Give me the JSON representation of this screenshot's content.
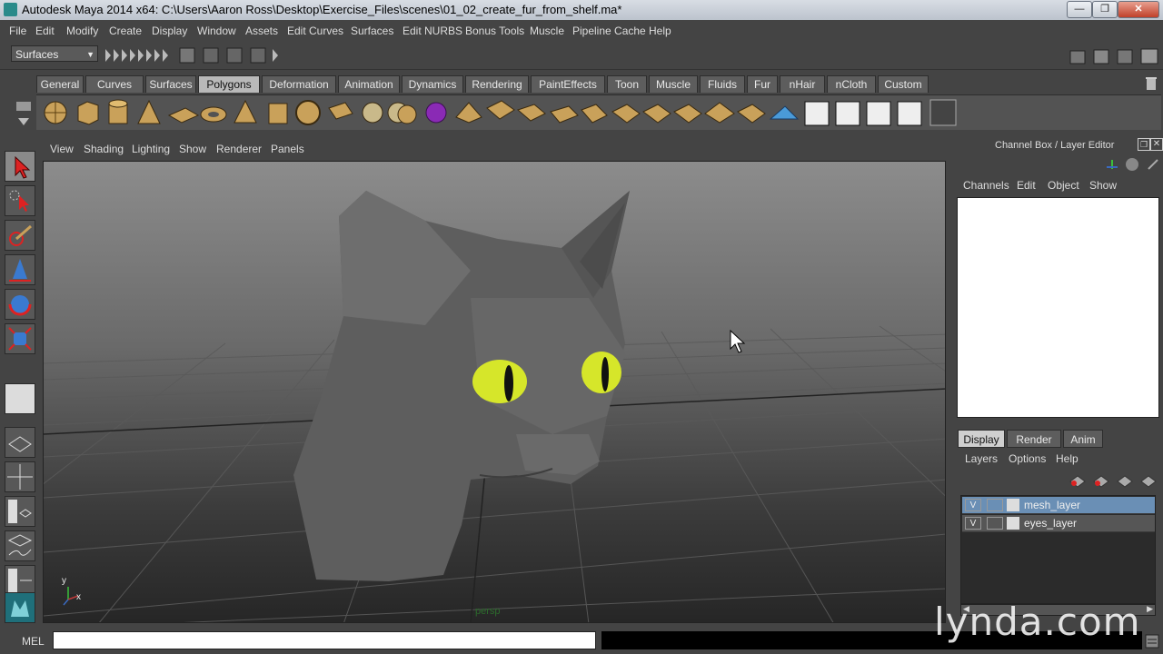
{
  "window": {
    "title": "Autodesk Maya 2014 x64: C:\\Users\\Aaron Ross\\Desktop\\Exercise_Files\\scenes\\01_02_create_fur_from_shelf.ma*",
    "minimize": "—",
    "maximize": "❐",
    "close": "✕"
  },
  "menubar": {
    "items": [
      "File",
      "Edit",
      "Modify",
      "Create",
      "Display",
      "Window",
      "Assets",
      "Edit Curves",
      "Surfaces",
      "Edit NURBS",
      "Bonus Tools",
      "Muscle",
      "Pipeline Cache",
      "Help"
    ]
  },
  "statusline": {
    "mode": "Surfaces"
  },
  "shelf": {
    "tabs": [
      "General",
      "Curves",
      "Surfaces",
      "Polygons",
      "Deformation",
      "Animation",
      "Dynamics",
      "Rendering",
      "PaintEffects",
      "Toon",
      "Muscle",
      "Fluids",
      "Fur",
      "nHair",
      "nCloth",
      "Custom"
    ],
    "active_tab": "Polygons"
  },
  "panel": {
    "menus": [
      "View",
      "Shading",
      "Lighting",
      "Show",
      "Renderer",
      "Panels"
    ],
    "camera_label": "persp",
    "axis_y": "y",
    "axis_x": "x"
  },
  "channelbox": {
    "title": "Channel Box / Layer Editor",
    "menus": [
      "Channels",
      "Edit",
      "Object",
      "Show"
    ]
  },
  "layer_editor": {
    "tabs": [
      "Display",
      "Render",
      "Anim"
    ],
    "active_tab": "Display",
    "menus": [
      "Layers",
      "Options",
      "Help"
    ],
    "layers": [
      {
        "visible": "V",
        "name": "mesh_layer",
        "color": "#d8d8d8",
        "selected": true
      },
      {
        "visible": "V",
        "name": "eyes_layer",
        "color": "#d8d8d8",
        "selected": false
      }
    ]
  },
  "commandline": {
    "label": "MEL",
    "value": ""
  },
  "watermark": "lynda.com",
  "colors": {
    "ui_bg": "#444444",
    "active_tab": "#b9b9b9",
    "selected_layer": "#6a8fb5",
    "cat_eye": "#d6e62a"
  }
}
